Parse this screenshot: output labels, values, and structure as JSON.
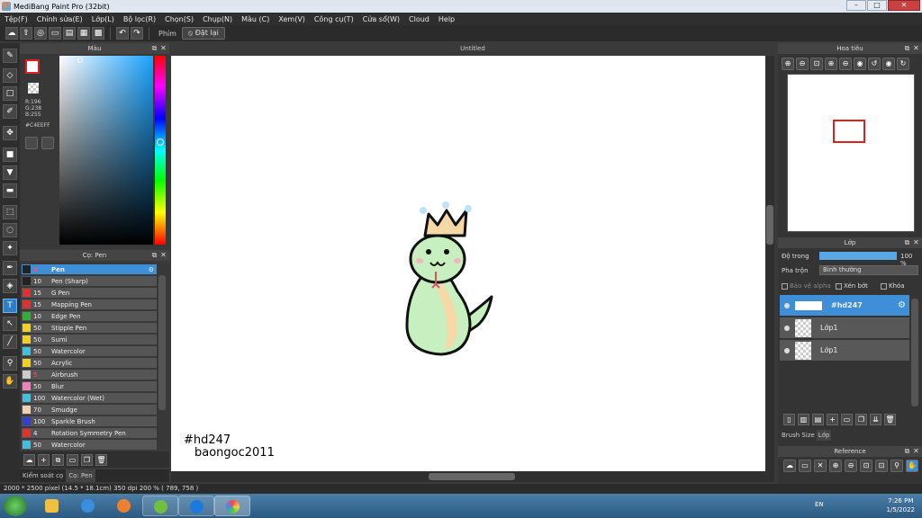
{
  "window": {
    "title": "MediBang Paint Pro (32bit)",
    "min": "–",
    "max": "□",
    "close": "✕"
  },
  "menu": [
    "Tệp(F)",
    "Chỉnh sửa(E)",
    "Lớp(L)",
    "Bộ lọc(R)",
    "Chọn(S)",
    "Chụp(N)",
    "Màu (C)",
    "Xem(V)",
    "Công cụ(T)",
    "Cửa sổ(W)",
    "Cloud",
    "Help"
  ],
  "toolbar": {
    "snap_label": "Phím",
    "reset_label": "Đặt lại"
  },
  "color_panel": {
    "title": "Màu",
    "r": "R:196",
    "g": "G:238",
    "b": "B:255",
    "hex": "#C4EEFF",
    "foreground": "#ffffff",
    "background": "transparent"
  },
  "brush_panel": {
    "title": "Cọ: Pen",
    "items": [
      {
        "color": "#222222",
        "size": "2",
        "name": "Pen",
        "size_red": true
      },
      {
        "color": "#222222",
        "size": "10",
        "name": "Pen (Sharp)"
      },
      {
        "color": "#e03030",
        "size": "15",
        "name": "G Pen"
      },
      {
        "color": "#e03030",
        "size": "15",
        "name": "Mapping Pen"
      },
      {
        "color": "#30b030",
        "size": "10",
        "name": "Edge Pen"
      },
      {
        "color": "#f0d020",
        "size": "50",
        "name": "Stipple Pen"
      },
      {
        "color": "#f0d020",
        "size": "50",
        "name": "Sumi"
      },
      {
        "color": "#40c0e0",
        "size": "50",
        "name": "Watercolor"
      },
      {
        "color": "#f0d020",
        "size": "50",
        "name": "Acrylic"
      },
      {
        "color": "#cccccc",
        "size": "5",
        "name": "Airbrush",
        "size_red": true
      },
      {
        "color": "#f080c0",
        "size": "50",
        "name": "Blur"
      },
      {
        "color": "#40c0e0",
        "size": "100",
        "name": "Watercolor (Wet)"
      },
      {
        "color": "#f0d0b0",
        "size": "70",
        "name": "Smudge"
      },
      {
        "color": "#3040d0",
        "size": "100",
        "name": "Sparkle Brush"
      },
      {
        "color": "#e03030",
        "size": "4",
        "name": "Rotation Symmetry Pen"
      },
      {
        "color": "#40c0e0",
        "size": "50",
        "name": "Watercolor"
      }
    ]
  },
  "bottom_tabs": [
    "Kiểm soát cọ",
    "Cọ: Pen"
  ],
  "document": {
    "tab": "Untitled",
    "signature_line1": "#hd247",
    "signature_line2": "baongoc2011"
  },
  "status": "2000 * 2500 pixel   (14.5 * 18.1cm)   350 dpi   200 %   ( 789, 758 )",
  "navigator": {
    "title": "Hoa tiêu"
  },
  "layer_panel": {
    "title": "Lớp",
    "opacity_label": "Độ trong",
    "opacity_value": "100 %",
    "opacity": 1.0,
    "blend_label": "Pha trộn",
    "blend_value": "Bình thường",
    "protect_alpha": "Bảo vệ alpha",
    "clipping": "Xén bớt",
    "lock": "Khóa",
    "layers": [
      {
        "name": "#hd247",
        "active": true
      },
      {
        "name": "Lớp1"
      },
      {
        "name": "Lớp1"
      }
    ],
    "tabs": [
      "Brush Size",
      "Lớp"
    ]
  },
  "reference": {
    "title": "Reference"
  },
  "taskbar": {
    "lang": "EN",
    "time": "7:26 PM",
    "date": "1/5/2022"
  }
}
